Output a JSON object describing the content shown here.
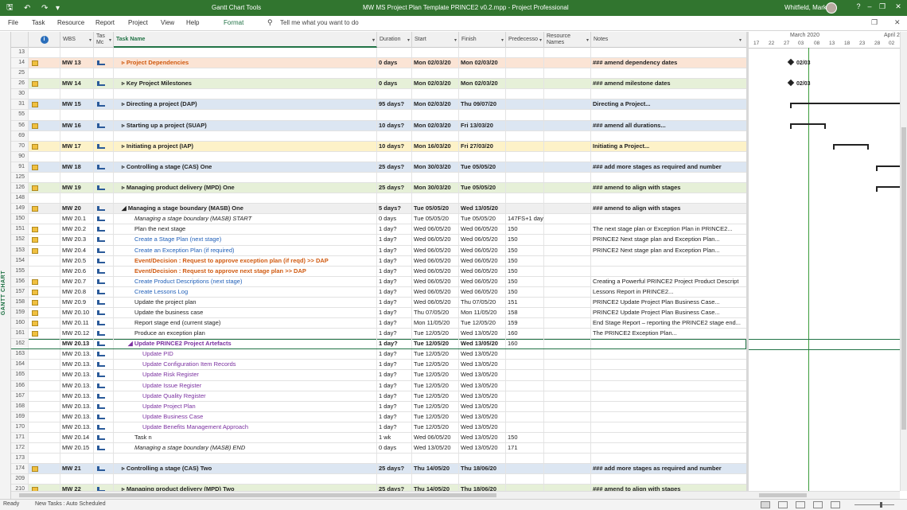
{
  "titlebar": {
    "tools": "Gantt Chart Tools",
    "title": "MW MS Project Plan Template PRINCE2 v0.2.mpp  -  Project Professional",
    "user": "Whitfield, Mark",
    "help": "?",
    "minimize": "–",
    "restore": "❐",
    "close": "✕"
  },
  "ribbon": {
    "tabs": [
      "File",
      "Task",
      "Resource",
      "Report",
      "Project",
      "View",
      "Help"
    ],
    "format": "Format",
    "tell": "Tell me what you want to do",
    "restore": "❐",
    "close": "✕"
  },
  "side_label": "GANTT CHART",
  "headers": {
    "ind": "i",
    "wbs": "WBS",
    "mode": "Tas Mc",
    "name": "Task Name",
    "dur": "Duration",
    "start": "Start",
    "fin": "Finish",
    "pred": "Predecesso",
    "res": "Resource Names",
    "notes": "Notes"
  },
  "rows": [
    {
      "id": "13",
      "wbs": "",
      "name": "",
      "dur": "",
      "start": "",
      "fin": "",
      "pred": "",
      "notes": "",
      "style": "",
      "note": false,
      "mode": false
    },
    {
      "id": "14",
      "wbs": "MW 13",
      "name": "▹ Project Dependencies",
      "dur": "0 days",
      "start": "Mon 02/03/20",
      "fin": "Mon 02/03/20",
      "pred": "",
      "notes": "### amend dependency dates",
      "style": "summary bg-orange",
      "note": true,
      "mode": true
    },
    {
      "id": "25",
      "wbs": "",
      "name": "",
      "dur": "",
      "start": "",
      "fin": "",
      "pred": "",
      "notes": "",
      "style": "",
      "note": false,
      "mode": false
    },
    {
      "id": "26",
      "wbs": "MW 14",
      "name": "▹ Key Project Milestones",
      "dur": "0 days",
      "start": "Mon 02/03/20",
      "fin": "Mon 02/03/20",
      "pred": "",
      "notes": "### amend milestone dates",
      "style": "summary bg-green",
      "note": true,
      "mode": true
    },
    {
      "id": "30",
      "wbs": "",
      "name": "",
      "dur": "",
      "start": "",
      "fin": "",
      "pred": "",
      "notes": "",
      "style": "",
      "note": false,
      "mode": false
    },
    {
      "id": "31",
      "wbs": "MW 15",
      "name": "▹ Directing a project (DAP)",
      "dur": "95 days?",
      "start": "Mon 02/03/20",
      "fin": "Thu 09/07/20",
      "pred": "",
      "notes": "Directing a Project...",
      "style": "summary bg-blue",
      "note": true,
      "mode": true
    },
    {
      "id": "55",
      "wbs": "",
      "name": "",
      "dur": "",
      "start": "",
      "fin": "",
      "pred": "",
      "notes": "",
      "style": "",
      "note": false,
      "mode": false
    },
    {
      "id": "56",
      "wbs": "MW 16",
      "name": "▹ Starting up a project (SUAP)",
      "dur": "10 days?",
      "start": "Mon 02/03/20",
      "fin": "Fri 13/03/20",
      "pred": "",
      "notes": "### amend all durations...",
      "style": "summary bg-blue",
      "note": true,
      "mode": true
    },
    {
      "id": "69",
      "wbs": "",
      "name": "",
      "dur": "",
      "start": "",
      "fin": "",
      "pred": "",
      "notes": "",
      "style": "",
      "note": false,
      "mode": false
    },
    {
      "id": "70",
      "wbs": "MW 17",
      "name": "▹ Initiating a project (IAP)",
      "dur": "10 days?",
      "start": "Mon 16/03/20",
      "fin": "Fri 27/03/20",
      "pred": "",
      "notes": "Initiating a Project...",
      "style": "summary bg-yellow",
      "note": true,
      "mode": true
    },
    {
      "id": "90",
      "wbs": "",
      "name": "",
      "dur": "",
      "start": "",
      "fin": "",
      "pred": "",
      "notes": "",
      "style": "",
      "note": false,
      "mode": false
    },
    {
      "id": "91",
      "wbs": "MW 18",
      "name": "▹ Controlling a stage (CAS) One",
      "dur": "25 days?",
      "start": "Mon 30/03/20",
      "fin": "Tue 05/05/20",
      "pred": "",
      "notes": "### add more stages as required and number",
      "style": "summary bg-blue",
      "note": true,
      "mode": true
    },
    {
      "id": "125",
      "wbs": "",
      "name": "",
      "dur": "",
      "start": "",
      "fin": "",
      "pred": "",
      "notes": "",
      "style": "",
      "note": false,
      "mode": false
    },
    {
      "id": "126",
      "wbs": "MW 19",
      "name": "▹ Managing product delivery (MPD) One",
      "dur": "25 days?",
      "start": "Mon 30/03/20",
      "fin": "Tue 05/05/20",
      "pred": "",
      "notes": "### amend to align with stages",
      "style": "summary bg-green",
      "note": true,
      "mode": true
    },
    {
      "id": "148",
      "wbs": "",
      "name": "",
      "dur": "",
      "start": "",
      "fin": "",
      "pred": "",
      "notes": "",
      "style": "",
      "note": false,
      "mode": false
    },
    {
      "id": "149",
      "wbs": "MW 20",
      "name": "◢ Managing a stage boundary (MASB) One",
      "dur": "5 days?",
      "start": "Tue 05/05/20",
      "fin": "Wed 13/05/20",
      "pred": "",
      "notes": "### amend to align with stages",
      "style": "summary bg-gray",
      "note": true,
      "mode": true
    },
    {
      "id": "150",
      "wbs": "MW 20.1",
      "name": "Managing a stage boundary (MASB) START",
      "dur": "0 days",
      "start": "Tue 05/05/20",
      "fin": "Tue 05/05/20",
      "pred": "147FS+1 day",
      "notes": "",
      "style": "ital i1",
      "note": false,
      "mode": true
    },
    {
      "id": "151",
      "wbs": "MW 20.2",
      "name": "Plan the next stage",
      "dur": "1 day?",
      "start": "Wed 06/05/20",
      "fin": "Wed 06/05/20",
      "pred": "150",
      "notes": "The next stage plan or Exception Plan in PRINCE2...",
      "style": "i1",
      "note": true,
      "mode": true
    },
    {
      "id": "152",
      "wbs": "MW 20.3",
      "name": "Create a Stage Plan (next stage)",
      "dur": "1 day?",
      "start": "Wed 06/05/20",
      "fin": "Wed 06/05/20",
      "pred": "150",
      "notes": "PRINCE2 Next stage plan and Exception Plan...",
      "style": "blue i1",
      "note": true,
      "mode": true
    },
    {
      "id": "153",
      "wbs": "MW 20.4",
      "name": "Create an Exception Plan (if required)",
      "dur": "1 day?",
      "start": "Wed 06/05/20",
      "fin": "Wed 06/05/20",
      "pred": "150",
      "notes": "PRINCE2 Next stage plan and Exception Plan...",
      "style": "blue i1",
      "note": true,
      "mode": true
    },
    {
      "id": "154",
      "wbs": "MW 20.5",
      "name": "Event/Decision : Request to approve exception plan (if reqd) >> DAP",
      "dur": "1 day?",
      "start": "Wed 06/05/20",
      "fin": "Wed 06/05/20",
      "pred": "150",
      "notes": "",
      "style": "orange i1",
      "note": false,
      "mode": true
    },
    {
      "id": "155",
      "wbs": "MW 20.6",
      "name": "Event/Decision : Request to approve next stage plan >> DAP",
      "dur": "1 day?",
      "start": "Wed 06/05/20",
      "fin": "Wed 06/05/20",
      "pred": "150",
      "notes": "",
      "style": "orange i1",
      "note": false,
      "mode": true
    },
    {
      "id": "156",
      "wbs": "MW 20.7",
      "name": "Create Product Descriptions (next stage)",
      "dur": "1 day?",
      "start": "Wed 06/05/20",
      "fin": "Wed 06/05/20",
      "pred": "150",
      "notes": "Creating a Powerful PRINCE2 Project Product Descript",
      "style": "blue i1",
      "note": true,
      "mode": true
    },
    {
      "id": "157",
      "wbs": "MW 20.8",
      "name": "Create Lessons Log",
      "dur": "1 day?",
      "start": "Wed 06/05/20",
      "fin": "Wed 06/05/20",
      "pred": "150",
      "notes": "Lessons Report in PRINCE2...",
      "style": "blue i1",
      "note": true,
      "mode": true
    },
    {
      "id": "158",
      "wbs": "MW 20.9",
      "name": "Update the project plan",
      "dur": "1 day?",
      "start": "Wed 06/05/20",
      "fin": "Thu 07/05/20",
      "pred": "151",
      "notes": "PRINCE2 Update Project Plan Business Case...",
      "style": "i1",
      "note": true,
      "mode": true
    },
    {
      "id": "159",
      "wbs": "MW 20.10",
      "name": "Update the business case",
      "dur": "1 day?",
      "start": "Thu 07/05/20",
      "fin": "Mon 11/05/20",
      "pred": "158",
      "notes": "PRINCE2 Update Project Plan Business Case...",
      "style": "i1",
      "note": true,
      "mode": true
    },
    {
      "id": "160",
      "wbs": "MW 20.11",
      "name": "Report stage end (current stage)",
      "dur": "1 day?",
      "start": "Mon 11/05/20",
      "fin": "Tue 12/05/20",
      "pred": "159",
      "notes": "End Stage Report – reporting the PRINCE2 stage end...",
      "style": "i1",
      "note": true,
      "mode": true
    },
    {
      "id": "161",
      "wbs": "MW 20.12",
      "name": "Produce an exception plan",
      "dur": "1 day?",
      "start": "Tue 12/05/20",
      "fin": "Wed 13/05/20",
      "pred": "160",
      "notes": "The PRINCE2 Exception Plan...",
      "style": "i1",
      "note": true,
      "mode": true
    },
    {
      "id": "162",
      "wbs": "MW 20.13",
      "name": "◢ Update PRINCE2 Project Artefacts",
      "dur": "1 day?",
      "start": "Tue 12/05/20",
      "fin": "Wed 13/05/20",
      "pred": "160",
      "notes": "",
      "style": "summary purple i1 sel",
      "note": false,
      "mode": true
    },
    {
      "id": "163",
      "wbs": "MW 20.13.",
      "name": "Update PID",
      "dur": "1 day?",
      "start": "Tue 12/05/20",
      "fin": "Wed 13/05/20",
      "pred": "",
      "notes": "",
      "style": "purple i2",
      "note": false,
      "mode": true
    },
    {
      "id": "164",
      "wbs": "MW 20.13.",
      "name": "Update Configuration Item Records",
      "dur": "1 day?",
      "start": "Tue 12/05/20",
      "fin": "Wed 13/05/20",
      "pred": "",
      "notes": "",
      "style": "purple i2",
      "note": false,
      "mode": true
    },
    {
      "id": "165",
      "wbs": "MW 20.13.",
      "name": "Update Risk Register",
      "dur": "1 day?",
      "start": "Tue 12/05/20",
      "fin": "Wed 13/05/20",
      "pred": "",
      "notes": "",
      "style": "purple i2",
      "note": false,
      "mode": true
    },
    {
      "id": "166",
      "wbs": "MW 20.13.",
      "name": "Update Issue Register",
      "dur": "1 day?",
      "start": "Tue 12/05/20",
      "fin": "Wed 13/05/20",
      "pred": "",
      "notes": "",
      "style": "purple i2",
      "note": false,
      "mode": true
    },
    {
      "id": "167",
      "wbs": "MW 20.13.",
      "name": "Update Quality Register",
      "dur": "1 day?",
      "start": "Tue 12/05/20",
      "fin": "Wed 13/05/20",
      "pred": "",
      "notes": "",
      "style": "purple i2",
      "note": false,
      "mode": true
    },
    {
      "id": "168",
      "wbs": "MW 20.13.",
      "name": "Update Project Plan",
      "dur": "1 day?",
      "start": "Tue 12/05/20",
      "fin": "Wed 13/05/20",
      "pred": "",
      "notes": "",
      "style": "purple i2",
      "note": false,
      "mode": true
    },
    {
      "id": "169",
      "wbs": "MW 20.13.",
      "name": "Update Business Case",
      "dur": "1 day?",
      "start": "Tue 12/05/20",
      "fin": "Wed 13/05/20",
      "pred": "",
      "notes": "",
      "style": "purple i2",
      "note": false,
      "mode": true
    },
    {
      "id": "170",
      "wbs": "MW 20.13.",
      "name": "Update Benefits Management Approach",
      "dur": "1 day?",
      "start": "Tue 12/05/20",
      "fin": "Wed 13/05/20",
      "pred": "",
      "notes": "",
      "style": "purple i2",
      "note": false,
      "mode": true
    },
    {
      "id": "171",
      "wbs": "MW 20.14",
      "name": "Task n",
      "dur": "1 wk",
      "start": "Wed 06/05/20",
      "fin": "Wed 13/05/20",
      "pred": "150",
      "notes": "",
      "style": "i1",
      "note": false,
      "mode": true
    },
    {
      "id": "172",
      "wbs": "MW 20.15",
      "name": "Managing a stage boundary (MASB) END",
      "dur": "0 days",
      "start": "Wed 13/05/20",
      "fin": "Wed 13/05/20",
      "pred": "171",
      "notes": "",
      "style": "ital i1",
      "note": false,
      "mode": true
    },
    {
      "id": "173",
      "wbs": "",
      "name": "",
      "dur": "",
      "start": "",
      "fin": "",
      "pred": "",
      "notes": "",
      "style": "",
      "note": false,
      "mode": false
    },
    {
      "id": "174",
      "wbs": "MW 21",
      "name": "▹ Controlling a stage (CAS) Two",
      "dur": "25 days?",
      "start": "Thu 14/05/20",
      "fin": "Thu 18/06/20",
      "pred": "",
      "notes": "### add more stages as required and number",
      "style": "summary bg-blue",
      "note": true,
      "mode": true
    },
    {
      "id": "209",
      "wbs": "",
      "name": "",
      "dur": "",
      "start": "",
      "fin": "",
      "pred": "",
      "notes": "",
      "style": "",
      "note": false,
      "mode": false
    },
    {
      "id": "210",
      "wbs": "MW 22",
      "name": "▹ Managing product delivery (MPD) Two",
      "dur": "25 days?",
      "start": "Thu 14/05/20",
      "fin": "Thu 18/06/20",
      "pred": "",
      "notes": "### amend to align with stages",
      "style": "summary bg-green",
      "note": true,
      "mode": true
    }
  ],
  "chart": {
    "month1": "March 2020",
    "month2": "April 2",
    "days": [
      "17",
      "22",
      "27",
      "03",
      "08",
      "13",
      "18",
      "23",
      "28",
      "02"
    ],
    "mile1": "02/03",
    "mile2": "02/03"
  },
  "status": {
    "ready": "Ready",
    "newtasks": "New Tasks : Auto Scheduled"
  }
}
